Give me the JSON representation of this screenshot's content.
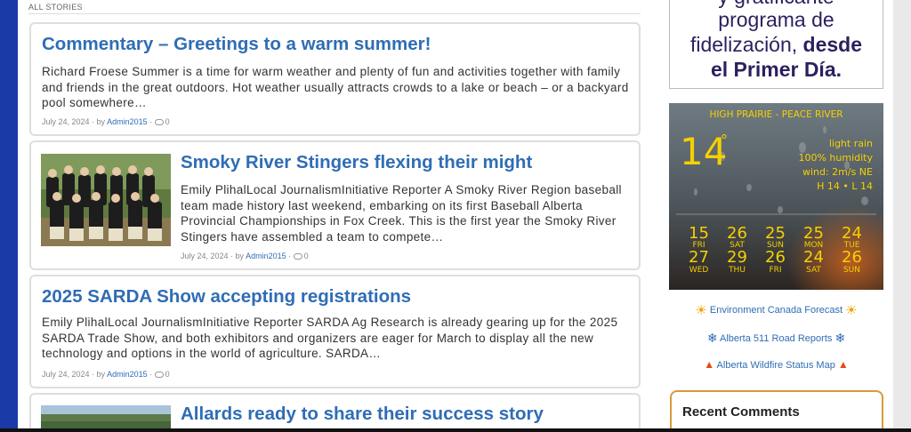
{
  "section_label": "ALL STORIES",
  "stories": [
    {
      "title": "Commentary – Greetings to a warm summer!",
      "excerpt": "Richard Froese Summer is a time for warm weather and plenty of fun and activities together with family and friends in the great outdoors. Hot weather usually attracts crowds to a lake or beach – or a backyard pool somewhere…",
      "date": "July 24, 2024",
      "by": "by",
      "author": "Admin2015",
      "comments": "0"
    },
    {
      "title": "Smoky River Stingers flexing their might",
      "excerpt": "Emily PlihalLocal JournalismInitiative Reporter A Smoky River Region baseball team made history last weekend, embarking on its first Baseball Alberta Provincial Championships in Fox Creek. This is the first year the Smoky River Stingers have assembled a team to compete…",
      "date": "July 24, 2024",
      "by": "by",
      "author": "Admin2015",
      "comments": "0"
    },
    {
      "title": "2025 SARDA Show accepting registrations",
      "excerpt": "Emily PlihalLocal JournalismInitiative Reporter SARDA Ag Research is already gearing up for the 2025 SARDA Trade Show, and both exhibitors and organizers are eager for March to display all the new technology and options in the world of agriculture. SARDA…",
      "date": "July 24, 2024",
      "by": "by",
      "author": "Admin2015",
      "comments": "0"
    },
    {
      "title": "Allards ready to share their success story"
    }
  ],
  "ad": {
    "line1": "y gratificante",
    "line2": "programa de",
    "line3_a": "fidelización, ",
    "line3_b": "desde",
    "line4": "el Primer Día."
  },
  "weather": {
    "location": "HIGH PRAIRIE - PEACE RIVER",
    "temp": "14",
    "deg": "°",
    "condition": "light rain",
    "humidity": "100% humidity",
    "wind": "wind: 2m/s NE",
    "hilo": "H 14 • L 14",
    "forecast": [
      {
        "high": "15",
        "hday": "FRI",
        "low": "27",
        "lday": "WED"
      },
      {
        "high": "26",
        "hday": "SAT",
        "low": "29",
        "lday": "THU"
      },
      {
        "high": "25",
        "hday": "SUN",
        "low": "26",
        "lday": "FRI"
      },
      {
        "high": "25",
        "hday": "MON",
        "low": "24",
        "lday": "SAT"
      },
      {
        "high": "24",
        "hday": "TUE",
        "low": "26",
        "lday": "SUN"
      }
    ]
  },
  "links": {
    "forecast": "Environment Canada Forecast",
    "roads": "Alberta 511 Road Reports",
    "wildfire": "Alberta Wildfire Status Map"
  },
  "recent_comments": "Recent Comments",
  "icons": {
    "sun": "sun-icon",
    "snowflake": "snowflake-icon",
    "fire": "fire-icon",
    "comment": "comment-icon"
  }
}
